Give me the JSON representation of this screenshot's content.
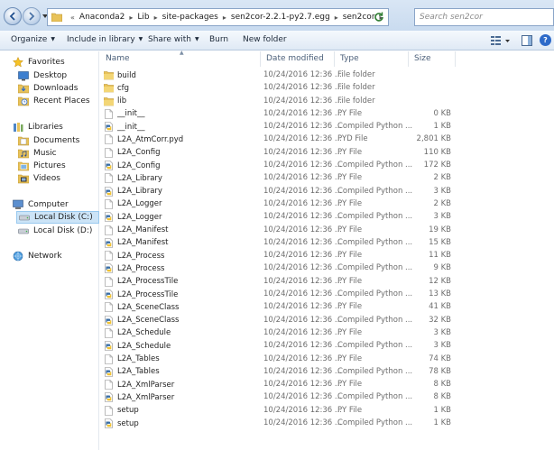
{
  "addressbar": {
    "overflow": "«",
    "crumbs": [
      "Anaconda2",
      "Lib",
      "site-packages",
      "sen2cor-2.2.1-py2.7.egg",
      "sen2cor"
    ],
    "search_placeholder": "Search sen2cor"
  },
  "toolbar": {
    "organize": "Organize",
    "include_in_library": "Include in library",
    "share_with": "Share with",
    "burn": "Burn",
    "new_folder": "New folder",
    "help": "?"
  },
  "navpane": {
    "favorites": "Favorites",
    "desktop": "Desktop",
    "downloads": "Downloads",
    "recent_places": "Recent Places",
    "libraries": "Libraries",
    "documents": "Documents",
    "music": "Music",
    "pictures": "Pictures",
    "videos": "Videos",
    "computer": "Computer",
    "local_disk_c": "Local Disk (C:)",
    "local_disk_d": "Local Disk (D:)",
    "network": "Network"
  },
  "columns": {
    "name": "Name",
    "date": "Date modified",
    "type": "Type",
    "size": "Size"
  },
  "files": [
    {
      "name": "build",
      "date": "10/24/2016 12:36 ...",
      "type": "File folder",
      "size": "",
      "icon": "folder"
    },
    {
      "name": "cfg",
      "date": "10/24/2016 12:36 ...",
      "type": "File folder",
      "size": "",
      "icon": "folder"
    },
    {
      "name": "lib",
      "date": "10/24/2016 12:36 ...",
      "type": "File folder",
      "size": "",
      "icon": "folder"
    },
    {
      "name": "__init__",
      "date": "10/24/2016 12:36 ...",
      "type": "PY File",
      "size": "0 KB",
      "icon": "py"
    },
    {
      "name": "__init__",
      "date": "10/24/2016 12:36 ...",
      "type": "Compiled Python ...",
      "size": "1 KB",
      "icon": "pyc"
    },
    {
      "name": "L2A_AtmCorr.pyd",
      "date": "10/24/2016 12:36 ...",
      "type": "PYD File",
      "size": "2,801 KB",
      "icon": "pyd"
    },
    {
      "name": "L2A_Config",
      "date": "10/24/2016 12:36 ...",
      "type": "PY File",
      "size": "110 KB",
      "icon": "py"
    },
    {
      "name": "L2A_Config",
      "date": "10/24/2016 12:36 ...",
      "type": "Compiled Python ...",
      "size": "172 KB",
      "icon": "pyc"
    },
    {
      "name": "L2A_Library",
      "date": "10/24/2016 12:36 ...",
      "type": "PY File",
      "size": "2 KB",
      "icon": "py"
    },
    {
      "name": "L2A_Library",
      "date": "10/24/2016 12:36 ...",
      "type": "Compiled Python ...",
      "size": "3 KB",
      "icon": "pyc"
    },
    {
      "name": "L2A_Logger",
      "date": "10/24/2016 12:36 ...",
      "type": "PY File",
      "size": "2 KB",
      "icon": "py"
    },
    {
      "name": "L2A_Logger",
      "date": "10/24/2016 12:36 ...",
      "type": "Compiled Python ...",
      "size": "3 KB",
      "icon": "pyc"
    },
    {
      "name": "L2A_Manifest",
      "date": "10/24/2016 12:36 ...",
      "type": "PY File",
      "size": "19 KB",
      "icon": "py"
    },
    {
      "name": "L2A_Manifest",
      "date": "10/24/2016 12:36 ...",
      "type": "Compiled Python ...",
      "size": "15 KB",
      "icon": "pyc"
    },
    {
      "name": "L2A_Process",
      "date": "10/24/2016 12:36 ...",
      "type": "PY File",
      "size": "11 KB",
      "icon": "py"
    },
    {
      "name": "L2A_Process",
      "date": "10/24/2016 12:36 ...",
      "type": "Compiled Python ...",
      "size": "9 KB",
      "icon": "pyc"
    },
    {
      "name": "L2A_ProcessTile",
      "date": "10/24/2016 12:36 ...",
      "type": "PY File",
      "size": "12 KB",
      "icon": "py"
    },
    {
      "name": "L2A_ProcessTile",
      "date": "10/24/2016 12:36 ...",
      "type": "Compiled Python ...",
      "size": "13 KB",
      "icon": "pyc"
    },
    {
      "name": "L2A_SceneClass",
      "date": "10/24/2016 12:36 ...",
      "type": "PY File",
      "size": "41 KB",
      "icon": "py"
    },
    {
      "name": "L2A_SceneClass",
      "date": "10/24/2016 12:36 ...",
      "type": "Compiled Python ...",
      "size": "32 KB",
      "icon": "pyc"
    },
    {
      "name": "L2A_Schedule",
      "date": "10/24/2016 12:36 ...",
      "type": "PY File",
      "size": "3 KB",
      "icon": "py"
    },
    {
      "name": "L2A_Schedule",
      "date": "10/24/2016 12:36 ...",
      "type": "Compiled Python ...",
      "size": "3 KB",
      "icon": "pyc"
    },
    {
      "name": "L2A_Tables",
      "date": "10/24/2016 12:36 ...",
      "type": "PY File",
      "size": "74 KB",
      "icon": "py"
    },
    {
      "name": "L2A_Tables",
      "date": "10/24/2016 12:36 ...",
      "type": "Compiled Python ...",
      "size": "78 KB",
      "icon": "pyc"
    },
    {
      "name": "L2A_XmlParser",
      "date": "10/24/2016 12:36 ...",
      "type": "PY File",
      "size": "8 KB",
      "icon": "py"
    },
    {
      "name": "L2A_XmlParser",
      "date": "10/24/2016 12:36 ...",
      "type": "Compiled Python ...",
      "size": "8 KB",
      "icon": "pyc"
    },
    {
      "name": "setup",
      "date": "10/24/2016 12:36 ...",
      "type": "PY File",
      "size": "1 KB",
      "icon": "py"
    },
    {
      "name": "setup",
      "date": "10/24/2016 12:36 ...",
      "type": "Compiled Python ...",
      "size": "1 KB",
      "icon": "pyc"
    }
  ]
}
